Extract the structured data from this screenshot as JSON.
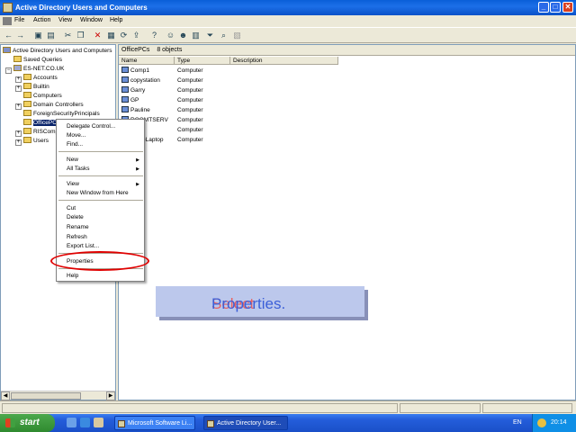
{
  "window": {
    "title": "Active Directory Users and Computers",
    "controls": [
      "_",
      "□",
      "✕"
    ]
  },
  "menu": [
    "File",
    "Action",
    "View",
    "Window",
    "Help"
  ],
  "toolbar_icons": [
    "back-icon",
    "forward-icon",
    "up-icon",
    "show-console-tree-icon",
    "cut-icon",
    "copy-icon",
    "delete-icon",
    "properties-icon",
    "refresh-icon",
    "export-icon",
    "help-icon",
    "new-user-icon",
    "new-group-icon",
    "new-ou-icon",
    "filter-icon",
    "find-icon",
    "add-to-group-icon"
  ],
  "tree": {
    "root": "Active Directory Users and Computers",
    "items": [
      {
        "label": "Saved Queries",
        "level": 1,
        "exp": ""
      },
      {
        "label": "ES-NET.CO.UK",
        "level": 1,
        "exp": "−"
      },
      {
        "label": "Accounts",
        "level": 2,
        "exp": "+"
      },
      {
        "label": "Builtin",
        "level": 2,
        "exp": "+"
      },
      {
        "label": "Computers",
        "level": 2,
        "exp": ""
      },
      {
        "label": "Domain Controllers",
        "level": 2,
        "exp": "+"
      },
      {
        "label": "ForeignSecurityPrincipals",
        "level": 2,
        "exp": ""
      },
      {
        "label": "OfficePCs",
        "level": 2,
        "exp": "",
        "selected": true
      },
      {
        "label": "RISComp",
        "level": 2,
        "exp": "+"
      },
      {
        "label": "Users",
        "level": 2,
        "exp": "+"
      }
    ]
  },
  "details": {
    "header_title": "OfficePCs",
    "header_count": "8 objects",
    "columns": [
      "Name",
      "Type",
      "Description"
    ],
    "rows": [
      {
        "name": "Comp1",
        "type": "Computer"
      },
      {
        "name": "copystation",
        "type": "Computer"
      },
      {
        "name": "Garry",
        "type": "Computer"
      },
      {
        "name": "GP",
        "type": "Computer"
      },
      {
        "name": "Pauline",
        "type": "Computer"
      },
      {
        "name": "ROOMTSERV",
        "type": "Computer"
      },
      {
        "name": "ric",
        "type": "Computer"
      },
      {
        "name": "SteveLaptop",
        "type": "Computer"
      }
    ]
  },
  "context_menu": {
    "items": [
      {
        "label": "Delegate Control...",
        "sub": false
      },
      {
        "label": "Move...",
        "sub": false
      },
      {
        "label": "Find...",
        "sub": false
      },
      {
        "sep": true
      },
      {
        "label": "New",
        "sub": true
      },
      {
        "label": "All Tasks",
        "sub": true
      },
      {
        "sep": true
      },
      {
        "label": "View",
        "sub": true
      },
      {
        "label": "New Window from Here",
        "sub": false
      },
      {
        "sep": true
      },
      {
        "label": "Cut",
        "sub": false
      },
      {
        "label": "Delete",
        "sub": false
      },
      {
        "label": "Rename",
        "sub": false
      },
      {
        "label": "Refresh",
        "sub": false
      },
      {
        "label": "Export List...",
        "sub": false
      },
      {
        "sep": true
      },
      {
        "label": "Properties",
        "sub": false,
        "highlighted": true
      },
      {
        "sep": true
      },
      {
        "label": "Help",
        "sub": false
      }
    ]
  },
  "callout": {
    "word1": "Select",
    "word2": "Properties."
  },
  "taskbar": {
    "start_label": "start",
    "buttons": [
      "Microsoft Software Li...",
      "Active Directory User..."
    ],
    "language": "EN",
    "clock": "20:14"
  },
  "colors": {
    "title_blue": "#0a5fd8",
    "highlight_red": "#e00000",
    "callout_bg": "#bcc8ec"
  }
}
